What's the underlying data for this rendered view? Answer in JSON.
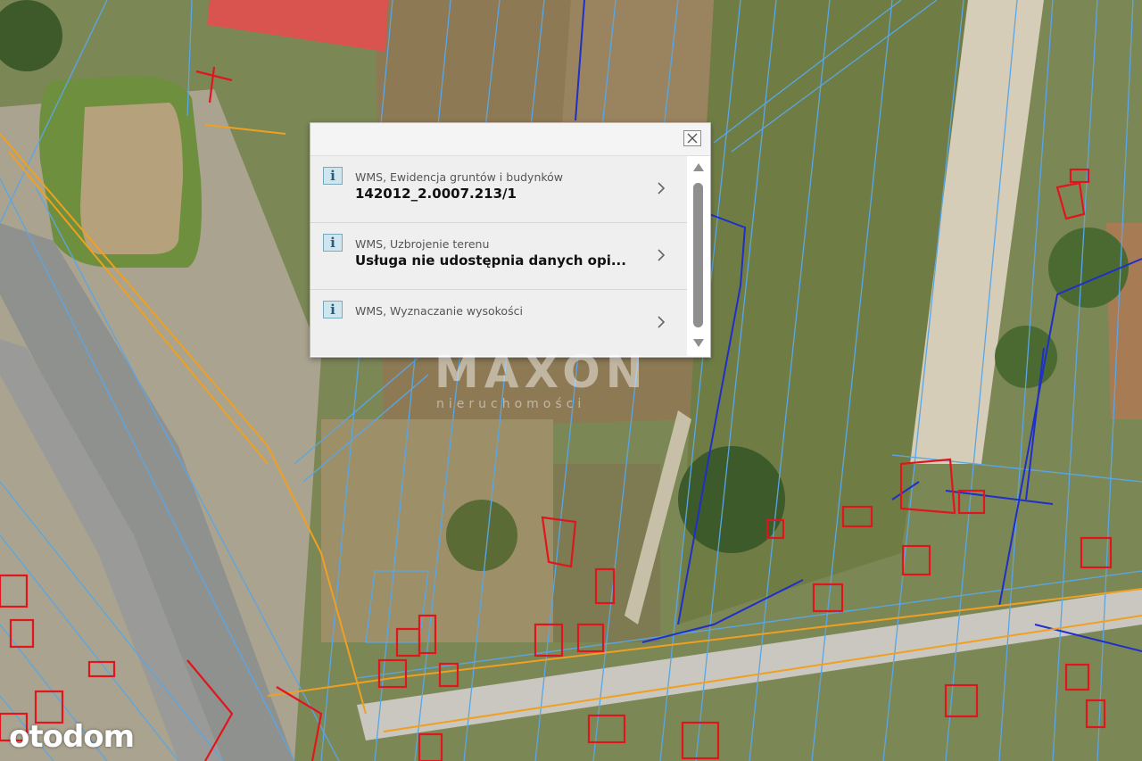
{
  "popup": {
    "close_label": "×",
    "items": [
      {
        "source": "WMS, Ewidencja gruntów i budynków",
        "value": "142012_2.0007.213/1"
      },
      {
        "source": "WMS, Uzbrojenie terenu",
        "value": "Usługa nie udostępnia danych opi..."
      },
      {
        "source": "WMS, Wyznaczanie wysokości",
        "value": ""
      }
    ],
    "info_icon": "i"
  },
  "watermark": {
    "brand": "MAXON",
    "tagline": "nieruchomości"
  },
  "logo": {
    "text": "otodom"
  },
  "colors": {
    "parcel_lines": "#5aa6e6",
    "utility_blue": "#1f2fc8",
    "buildings": "#e0161c",
    "gas_lines": "#f0a020",
    "road": "#8f918e"
  }
}
